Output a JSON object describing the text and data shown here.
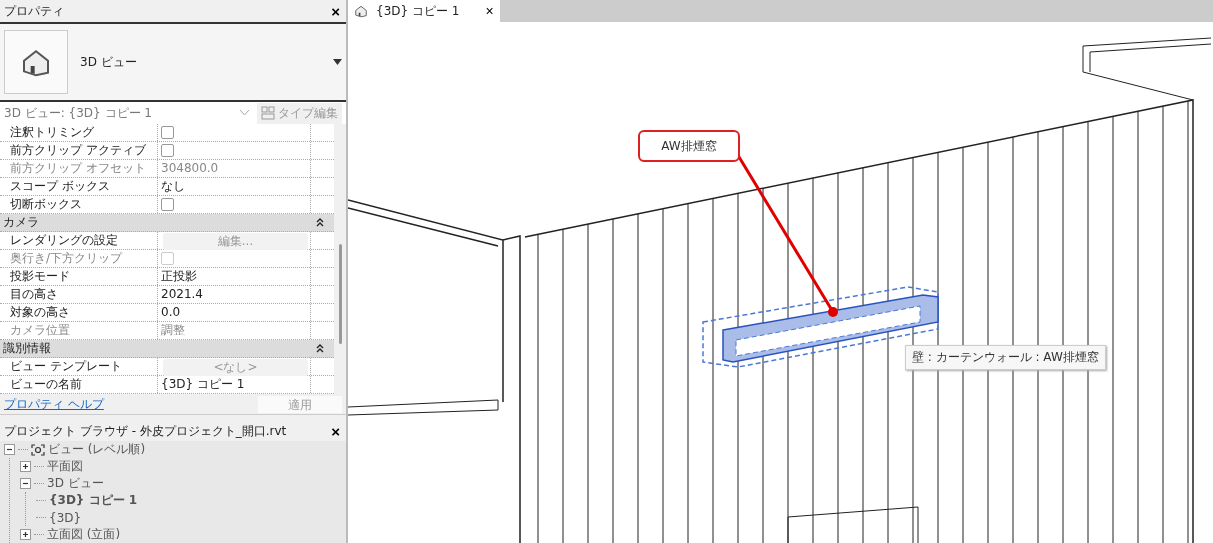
{
  "properties_panel": {
    "title": "プロパティ",
    "close": "×",
    "type_selector": {
      "name": "3D ビュー"
    },
    "instance_selector": {
      "value": "3D ビュー: {3D} コピー 1",
      "edit_type": {
        "label": "タイプ編集",
        "disabled": true
      }
    },
    "sections": [
      {
        "rows": [
          {
            "name": "注釈トリミング",
            "kind": "checkbox",
            "checked": false,
            "disabled": false
          },
          {
            "name": "前方クリップ アクティブ",
            "kind": "checkbox",
            "checked": false,
            "disabled": false
          },
          {
            "name": "前方クリップ オフセット",
            "kind": "text",
            "value": "304800.0",
            "disabled": true
          },
          {
            "name": "スコープ ボックス",
            "kind": "text",
            "value": "なし",
            "disabled": false
          },
          {
            "name": "切断ボックス",
            "kind": "checkbox",
            "checked": false,
            "disabled": false
          }
        ]
      },
      {
        "title": "カメラ",
        "expanded": true,
        "rows": [
          {
            "name": "レンダリングの設定",
            "kind": "button",
            "value": "編集...",
            "disabled": false
          },
          {
            "name": "奥行き/下方クリップ",
            "kind": "checkbox",
            "checked": false,
            "disabled": true
          },
          {
            "name": "投影モード",
            "kind": "text",
            "value": "正投影",
            "disabled": false
          },
          {
            "name": "目の高さ",
            "kind": "text",
            "value": "2021.4",
            "disabled": false
          },
          {
            "name": "対象の高さ",
            "kind": "text",
            "value": "0.0",
            "disabled": false
          },
          {
            "name": "カメラ位置",
            "kind": "text",
            "value": "調整",
            "disabled": true
          }
        ]
      },
      {
        "title": "識別情報",
        "expanded": true,
        "rows": [
          {
            "name": "ビュー テンプレート",
            "kind": "button",
            "value": "<なし>",
            "disabled": false
          },
          {
            "name": "ビューの名前",
            "kind": "text",
            "value": "{3D} コピー 1",
            "disabled": false
          }
        ]
      }
    ],
    "help_link": "プロパティ ヘルプ",
    "apply": {
      "label": "適用",
      "disabled": true
    }
  },
  "project_browser": {
    "title": "プロジェクト ブラウザ - 外皮プロジェクト_開口.rvt",
    "close": "×",
    "tree": [
      {
        "label": "ビュー (レベル順)",
        "expanded": true,
        "children": [
          {
            "label": "平面図",
            "expanded": false
          },
          {
            "label": "3D ビュー",
            "expanded": true,
            "children": [
              {
                "label": "{3D} コピー 1",
                "current": true
              },
              {
                "label": "{3D}",
                "current": false
              }
            ]
          },
          {
            "label": "立面図 (立面)",
            "expanded": false
          }
        ]
      }
    ]
  },
  "tabs": [
    {
      "label": "{3D} コピー 1",
      "close": "×",
      "selected": true
    }
  ],
  "viewport": {
    "callout": "AW排煙窓",
    "tooltip": "壁 : カーテンウォール : AW排煙窓"
  }
}
